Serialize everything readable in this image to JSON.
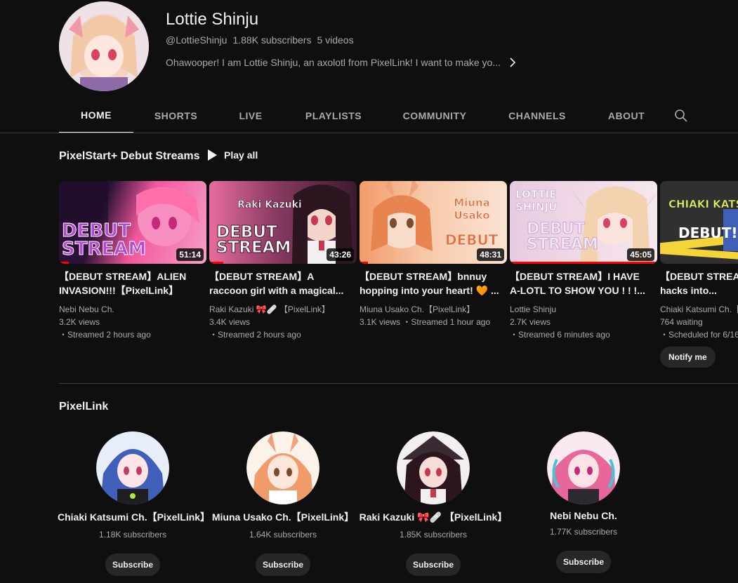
{
  "channel": {
    "title": "Lottie Shinju",
    "handle": "@LottieShinju",
    "subscribers": "1.88K subscribers",
    "videos": "5 videos",
    "description": "Ohawooper! I am Lottie Shinju, an axolotl from PixelLink! I want to make yo..."
  },
  "tabs": [
    {
      "label": "HOME",
      "active": true
    },
    {
      "label": "SHORTS"
    },
    {
      "label": "LIVE"
    },
    {
      "label": "PLAYLISTS"
    },
    {
      "label": "COMMUNITY"
    },
    {
      "label": "CHANNELS"
    },
    {
      "label": "ABOUT"
    }
  ],
  "shelf1": {
    "title": "PixelStart+ Debut Streams",
    "play_all": "Play all",
    "videos": [
      {
        "thumb_text": "DEBUT STREAM",
        "duration": "51:14",
        "title": "【DEBUT STREAM】ALIEN INVASION!!!【PixelLink】",
        "channel": "Nebi Nebu Ch.",
        "views": "3.2K views",
        "time": "・Streamed 2 hours ago",
        "colors": {
          "bg": "#f2579c",
          "bg2": "#2a1236",
          "text": "#b847d8"
        }
      },
      {
        "thumb_text": "DEBUT STREAM",
        "thumb_sub": "Raki Kazuki",
        "duration": "43:26",
        "title": "【DEBUT STREAM】A raccoon girl with a magical...",
        "channel": "Raki Kazuki 🎀🩹 【PixelLink】",
        "views": "3.4K views",
        "time": "・Streamed 2 hours ago",
        "colors": {
          "bg": "#4a1f3a",
          "bg2": "#e66d9d",
          "text": "#ffffff"
        }
      },
      {
        "thumb_text": "DEBUT",
        "thumb_sub": "Miuna Usako",
        "duration": "48:31",
        "title": "【DEBUT STREAM】bnnuy hopping into your heart! 🧡 ...",
        "channel": "Miuna Usako Ch.【PixelLink】",
        "views": "3.1K views",
        "time": "・Streamed 1 hour ago",
        "colors": {
          "bg": "#f7c9a9",
          "bg2": "#f29b6a",
          "text": "#e86f3c"
        }
      },
      {
        "thumb_text": "DEBUT STREAM",
        "thumb_sub": "LOTTIE SHINJU",
        "duration": "45:05",
        "title": "【DEBUT STREAM】I HAVE A-LOTL TO SHOW YOU ! ! !...",
        "channel": "Lottie Shinju",
        "views": "2.7K views",
        "time": "・Streamed 6 minutes ago",
        "colors": {
          "bg": "#efd8e6",
          "bg2": "#d9b8d8",
          "text": "#f3e7f2"
        }
      },
      {
        "thumb_text": "DEBUT!",
        "thumb_sub": "CHIAKI KATSUMI",
        "title": "【DEBUT STREAM】Hacker hacks into...",
        "channel": "Chiaki Katsumi Ch.【",
        "views": "764 waiting",
        "time": "・Scheduled for 6/16",
        "notify": "Notify me",
        "colors": {
          "bg": "#2b2b2b",
          "bg2": "#f3d53a",
          "text": "#ffffff"
        }
      }
    ]
  },
  "shelf2": {
    "title": "PixelLink",
    "subscribe_label": "Subscribe",
    "channels": [
      {
        "name": "Chiaki Katsumi Ch.【PixelLink】",
        "subs": "1.18K subscribers",
        "color": "#3f5fb8"
      },
      {
        "name": "Miuna Usako Ch.【PixelLink】",
        "subs": "1.64K subscribers",
        "color": "#f2a57a"
      },
      {
        "name": "Raki Kazuki 🎀🩹 【PixelLink】",
        "subs": "1.85K subscribers",
        "color": "#3a2a33"
      },
      {
        "name": "Nebi Nebu Ch.",
        "subs": "1.77K subscribers",
        "color": "#e8679a"
      }
    ]
  }
}
